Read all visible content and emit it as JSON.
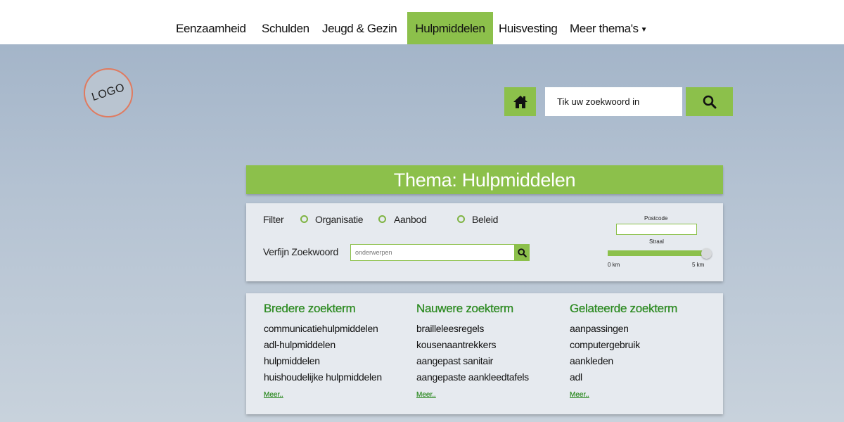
{
  "nav": {
    "items": [
      {
        "label": "Eenzaamheid",
        "active": false
      },
      {
        "label": "Schulden",
        "active": false
      },
      {
        "label": "Jeugd & Gezin",
        "active": false
      },
      {
        "label": "Hulpmiddelen",
        "active": true
      },
      {
        "label": "Huisvesting",
        "active": false
      }
    ],
    "more_label": "Meer thema's",
    "more_icon": "caret-down-icon"
  },
  "logo": {
    "text": "LOGO"
  },
  "search": {
    "home_icon": "home-icon",
    "placeholder": "Tik uw zoekwoord in",
    "button_icon": "search-icon"
  },
  "theme": {
    "title": "Thema: Hulpmiddelen"
  },
  "filter": {
    "label": "Filter",
    "options": [
      {
        "label": "Organisatie",
        "selected": false
      },
      {
        "label": "Aanbod",
        "selected": false
      },
      {
        "label": "Beleid",
        "selected": false
      }
    ],
    "refine_label": "Verfijn Zoekwoord",
    "refine_placeholder": "onderwerpen",
    "postcode_label": "Postcode",
    "straal_label": "Straal",
    "slider_min": "0 km",
    "slider_max": "5 km",
    "slider_value_km": 5
  },
  "terms": {
    "broader": {
      "title": "Bredere zoekterm",
      "items": [
        "communicatiehulpmiddelen",
        "adl-hulpmiddelen",
        "hulpmiddelen",
        "huishoudelijke hulpmiddelen"
      ],
      "more": "Meer.."
    },
    "narrower": {
      "title": "Nauwere zoekterm",
      "items": [
        "brailleleesregels",
        "kousenaantrekkers",
        "aangepast sanitair",
        "aangepaste aankleedtafels"
      ],
      "more": "Meer.."
    },
    "related": {
      "title": "Gelateerde zoekterm",
      "items": [
        "aanpassingen",
        "computergebruik",
        "aankleden",
        "adl"
      ],
      "more": "Meer.."
    }
  },
  "colors": {
    "accent": "#8cc04b",
    "heading_green": "#2e8b23",
    "logo_border": "#e07a5f"
  }
}
